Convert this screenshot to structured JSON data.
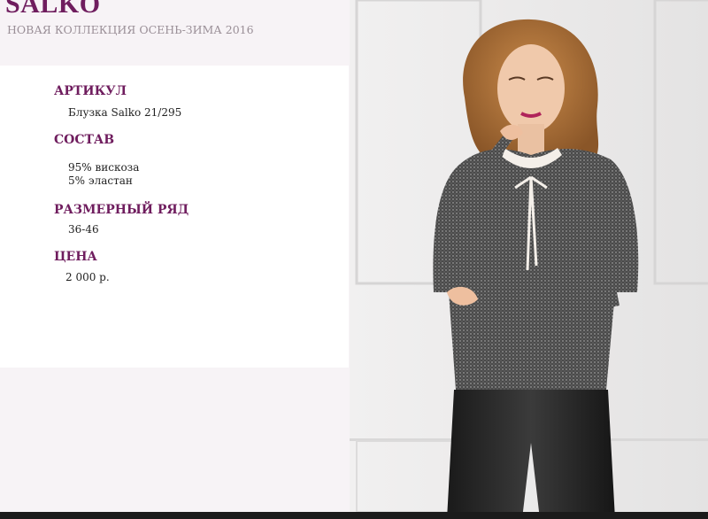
{
  "header": {
    "brand": "SALKO",
    "collection": "НОВАЯ КОЛЛЕКЦИЯ ОСЕНЬ-ЗИМА 2016"
  },
  "details": {
    "article": {
      "label": "АРТИКУЛ",
      "value": "Блузка Salko 21/295"
    },
    "composition": {
      "label": "СОСТАВ",
      "lines": [
        "95% вискоза",
        "5% эластан"
      ]
    },
    "sizes": {
      "label": "РАЗМЕРНЫЙ РЯД",
      "value": "36-46"
    },
    "price": {
      "label": "ЦЕНА",
      "value": "2 000 р."
    }
  },
  "colors": {
    "accent": "#6f1d5e",
    "subtitle": "#9a8f97",
    "page_background": "#f7f3f6"
  },
  "photo": {
    "subject": "model-photo"
  }
}
